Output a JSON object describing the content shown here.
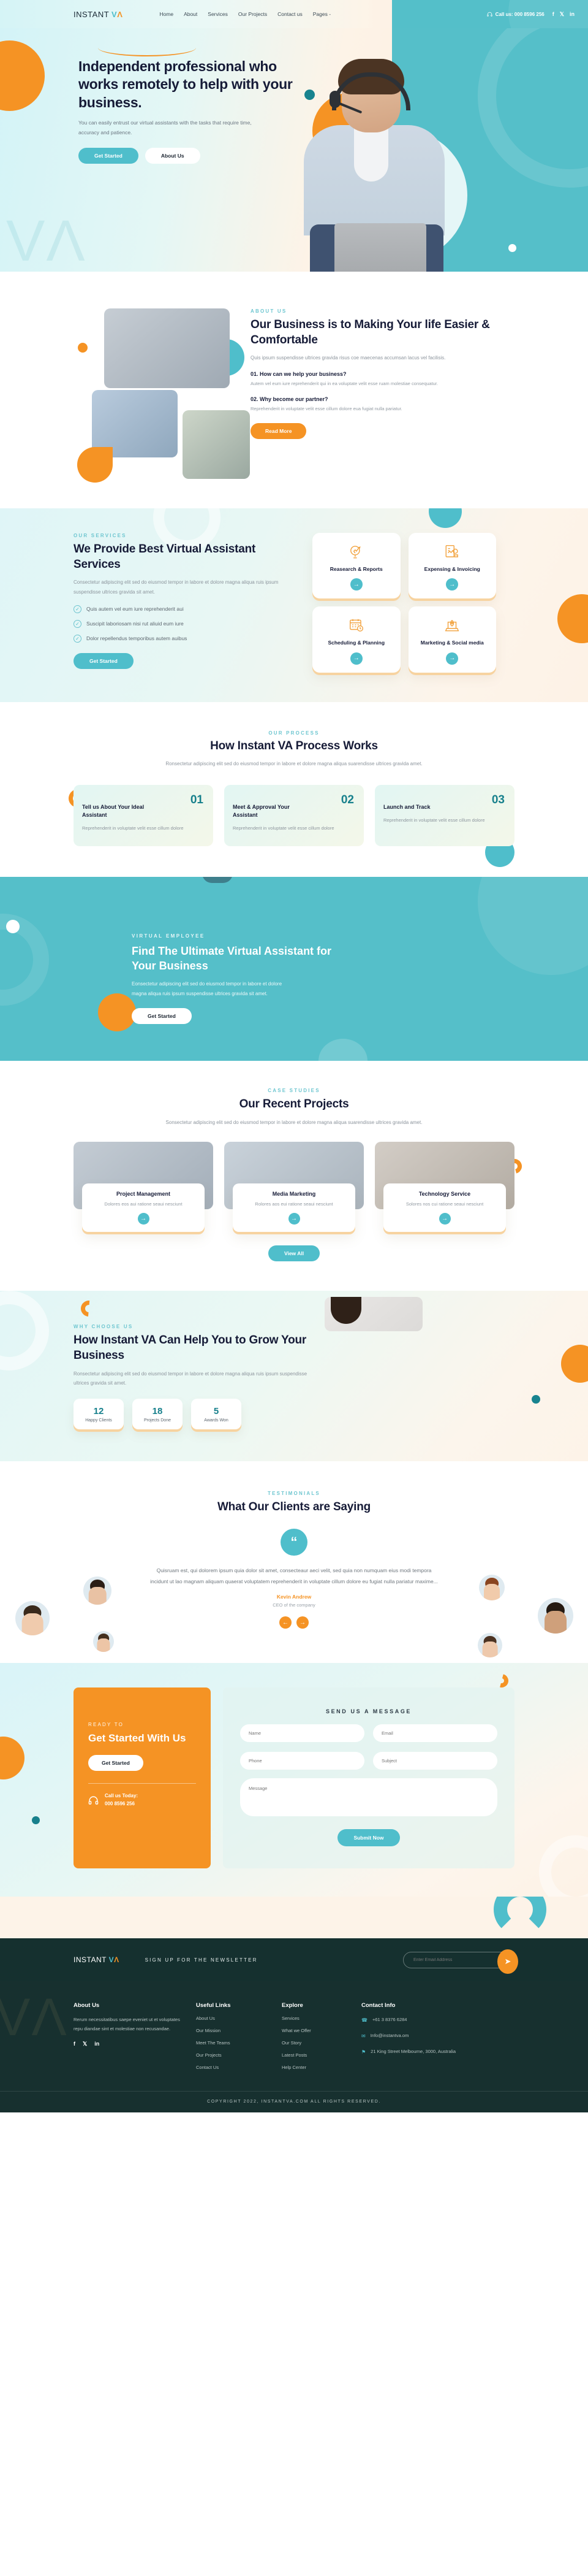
{
  "brand": {
    "name_1": "INSTANT ",
    "name_v": "V",
    "name_a": "Λ"
  },
  "header": {
    "nav": [
      {
        "label": "Home"
      },
      {
        "label": "About"
      },
      {
        "label": "Services"
      },
      {
        "label": "Our Projects"
      },
      {
        "label": "Contact us"
      },
      {
        "label": "Pages -"
      }
    ],
    "call_label": "Call us: 000 8596 256",
    "call_icon": "headset-icon",
    "social": [
      {
        "icon": "facebook-icon",
        "glyph": "f"
      },
      {
        "icon": "twitter-icon",
        "glyph": "𝕏"
      },
      {
        "icon": "linkedin-icon",
        "glyph": "in"
      }
    ]
  },
  "hero": {
    "title": "Independent professional who works remotely to help with your business.",
    "subtitle": "You can easily entrust our virtual assistants with the tasks that require time, accuracy and patience.",
    "primary_btn": "Get Started",
    "secondary_btn": "About Us",
    "watermark": "VΛ"
  },
  "about": {
    "eyebrow": "ABOUT US",
    "title": "Our Business is to Making Your life Easier & Comfortable",
    "desc": "Quis ipsum suspendisse ultrices gravida risus coe maecenas accumsan lacus vel facilisis.",
    "faqs": [
      {
        "q": "01. How can we help your business?",
        "a": "Autem vel eum iure reprehenderit qui in ea voluptate velit esse ruam molestiae consequatur."
      },
      {
        "q": "02. Why become our partner?",
        "a": "Reprehenderit in voluptate velit esse cillum dolore eua fugiat nulla pariatur."
      }
    ],
    "button": "Read More"
  },
  "services": {
    "eyebrow": "OUR SERVICES",
    "title": "We Provide Best Virtual Assistant Services",
    "desc": "Consectetur adipiscing elit sed do eiusmod tempor in labore et dolore magna aliqua ruis ipsum suspendisse ultrices gravida sit amet.",
    "checklist": [
      "Quis autem vel eum iure reprehenderit aui",
      "Suscipit laboriosam nisi rut aliuid eum iure",
      "Dolor repellendus temporibus autem auibus"
    ],
    "button": "Get Started",
    "cards": [
      {
        "title": "Reasearch & Reports",
        "icon": "research-magnifier-icon"
      },
      {
        "title": "Expensing & Invoicing",
        "icon": "invoice-chart-icon"
      },
      {
        "title": "Scheduling & Planning",
        "icon": "calendar-clock-icon"
      },
      {
        "title": "Marketing & Social media",
        "icon": "rocket-laptop-icon"
      }
    ]
  },
  "process": {
    "eyebrow": "OUR PROCESS",
    "title": "How Instant VA Process Works",
    "desc": "Ronsectetur adipiscing elit sed do eiusmod tempor in labore et dolore magna aliqua suarendisse ultrices gravida amet.",
    "steps": [
      {
        "num": "01",
        "title": "Tell us About Your Ideal Assistant",
        "desc": "Reprehenderit in voluptate velit esse cillum dolore"
      },
      {
        "num": "02",
        "title": "Meet & Approval Your Assistant",
        "desc": "Reprehenderit in voluptate velit esse cillum dolore"
      },
      {
        "num": "03",
        "title": "Launch and Track",
        "desc": "Reprehenderit in voluptate velit esse cillum dolore"
      }
    ]
  },
  "cta": {
    "eyebrow": "VIRTUAL EMPLOYEE",
    "title": "Find The Ultimate Virtual Assistant for Your Business",
    "desc": "Eonsectetur adipiscing elit sed do eiusmod tempor in labore et dolore magna aliqua ruis ipsum suspendisse ultrices gravida sit amet.",
    "button": "Get Started"
  },
  "projects": {
    "eyebrow": "CASE STUDIES",
    "title": "Our Recent Projects",
    "desc": "Sonsectetur adipiscing elit sed do eiusmod tempor in labore et dolore magna aliqua suarendisse ultrices gravida amet.",
    "items": [
      {
        "title": "Project Management",
        "desc": "Dolores eos aui ratione seaui nesciunt"
      },
      {
        "title": "Media Marketing",
        "desc": "Rolores aos eui ratione seaui nesciunt"
      },
      {
        "title": "Technology Service",
        "desc": "Solores nos cui ratione seaui nesciunt"
      }
    ],
    "view_all": "View All"
  },
  "why": {
    "eyebrow": "WHY CHOOSE US",
    "title": "How Instant VA Can Help You to Grow Your Business",
    "desc": "Ronsectetur adipiscing elit sed do eiusmod tempor in labore et dolore magna aliqua ruis ipsum suspendisse ultrices gravida sit amet.",
    "stats": [
      {
        "value": "12",
        "label": "Happy Clients"
      },
      {
        "value": "18",
        "label": "Projects Done"
      },
      {
        "value": "5",
        "label": "Awards Won"
      }
    ]
  },
  "testimonials": {
    "eyebrow": "TESTIMONIALS",
    "title": "What Our Clients are Saying",
    "quote_icon": "quote-icon",
    "text": "Quisruam est, qui dolorem ipsum quia dolor sit amet, consecteaur aeci velit, sed quia non numquam eius modi tempora incidunt ut lao magnam aliquam quaerat voluptatem reprehenderit in voluptate cillum dolore eu fugiat nulla pariatur maxime...",
    "author": "Kevin Andrew",
    "role": "CEO of the company",
    "prev_icon": "arrow-left-icon",
    "next_icon": "arrow-right-icon"
  },
  "contact": {
    "ready": "READY TO",
    "title": "Get Started With Us",
    "button": "Get Started",
    "call_label": "Call us Today:",
    "call_number": "000 8596 256",
    "form_title": "SEND US A MESSAGE",
    "fields": {
      "name": "Name",
      "email": "Email",
      "phone": "Phone",
      "subject": "Subject",
      "message": "Message"
    },
    "submit": "Submit Now"
  },
  "newsletter": {
    "label": "SIGN UP FOR THE NEWSLETTER",
    "placeholder": "Enter Email Address",
    "send_icon": "paper-plane-icon"
  },
  "footer": {
    "about": {
      "heading": "About Us",
      "text": "Rerum necessitatibus saepe eveniet ut et voluptates repu diandae sint et molestiae non recusandae.",
      "social": [
        {
          "icon": "facebook-icon",
          "glyph": "f"
        },
        {
          "icon": "twitter-icon",
          "glyph": "𝕏"
        },
        {
          "icon": "linkedin-icon",
          "glyph": "in"
        }
      ]
    },
    "useful": {
      "heading": "Useful Links",
      "links": [
        "About Us",
        "Our Mission",
        "Meet The Teams",
        "Our Projects",
        "Contact Us"
      ]
    },
    "explore": {
      "heading": "Explore",
      "links": [
        "Services",
        "What we Offer",
        "Our Story",
        "Latest Posts",
        "Help Center"
      ]
    },
    "contact": {
      "heading": "Contact Info",
      "items": [
        {
          "icon": "phone-icon",
          "glyph": "☎",
          "text": "+61 3 8376 6284"
        },
        {
          "icon": "mail-icon",
          "glyph": "✉",
          "text": "Info@instantva.om"
        },
        {
          "icon": "location-pin-icon",
          "glyph": "⚑",
          "text": "21 King Street Melbourne, 3000, Australia"
        }
      ]
    },
    "copyright": "COPYRIGHT 2022, INSTANTVA.COM ALL RIGHTS RESERVED."
  },
  "colors": {
    "teal": "#4fbecb",
    "orange": "#f59324",
    "dark": "#161b37",
    "footer_bg": "#17302f"
  }
}
